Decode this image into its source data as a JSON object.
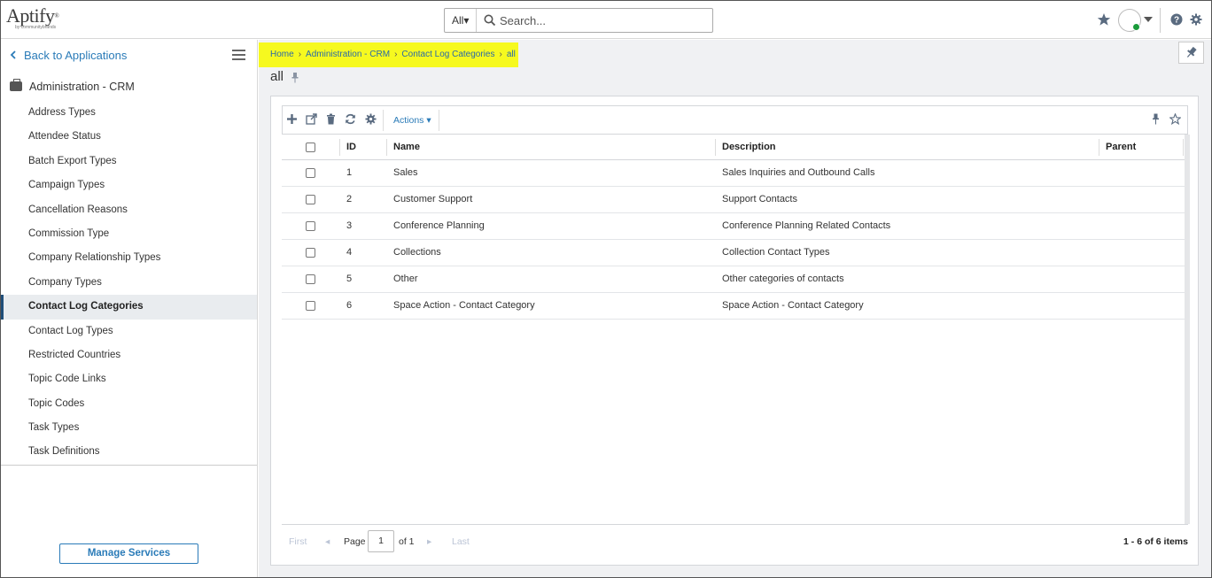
{
  "header": {
    "logo_main": "Aptify",
    "logo_reg": "®",
    "logo_sub": "by communitybrands",
    "search_scope": "All▾",
    "search_placeholder": "Search..."
  },
  "sidebar": {
    "back_label": "Back to Applications",
    "section_label": "Administration - CRM",
    "items": [
      {
        "label": "Address Types"
      },
      {
        "label": "Attendee Status"
      },
      {
        "label": "Batch Export Types"
      },
      {
        "label": "Campaign Types"
      },
      {
        "label": "Cancellation Reasons"
      },
      {
        "label": "Commission Type"
      },
      {
        "label": "Company Relationship Types"
      },
      {
        "label": "Company Types"
      },
      {
        "label": "Contact Log Categories",
        "active": true
      },
      {
        "label": "Contact Log Types"
      },
      {
        "label": "Restricted Countries"
      },
      {
        "label": "Topic Code Links"
      },
      {
        "label": "Topic Codes"
      },
      {
        "label": "Task Types"
      },
      {
        "label": "Task Definitions"
      }
    ],
    "manage_button": "Manage Services"
  },
  "breadcrumb": [
    "Home",
    "Administration - CRM",
    "Contact Log Categories",
    "all"
  ],
  "page_title": "all",
  "toolbar": {
    "actions_label": "Actions ▾"
  },
  "grid": {
    "columns": [
      "ID",
      "Name",
      "Description",
      "Parent"
    ],
    "rows": [
      {
        "id": "1",
        "name": "Sales",
        "description": "Sales Inquiries and Outbound Calls",
        "parent": ""
      },
      {
        "id": "2",
        "name": "Customer Support",
        "description": "Support Contacts",
        "parent": ""
      },
      {
        "id": "3",
        "name": "Conference Planning",
        "description": "Conference Planning Related Contacts",
        "parent": ""
      },
      {
        "id": "4",
        "name": "Collections",
        "description": "Collection Contact Types",
        "parent": ""
      },
      {
        "id": "5",
        "name": "Other",
        "description": "Other categories of contacts",
        "parent": ""
      },
      {
        "id": "6",
        "name": "Space Action - Contact Category",
        "description": "Space Action - Contact Category",
        "parent": ""
      }
    ]
  },
  "pager": {
    "first": "First",
    "prev": "◂",
    "page_label": "Page",
    "page_value": "1",
    "of_label": "of 1",
    "next": "▸",
    "last": "Last",
    "count": "1 - 6 of 6 items"
  },
  "colors": {
    "accent": "#2a7bb8",
    "breadcrumb_highlight": "#f6f91f",
    "active_nav_bg": "#e9ecef",
    "status_online": "#1a9b3a"
  }
}
